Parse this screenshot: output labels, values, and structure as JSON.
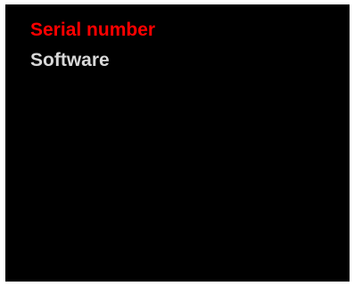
{
  "menu": {
    "items": [
      {
        "label": "Serial number",
        "selected": true
      },
      {
        "label": "Software",
        "selected": false
      }
    ]
  },
  "colors": {
    "background": "#000000",
    "selected_text": "#ff0000",
    "normal_text": "#d8d8d8",
    "border": "#ffffff"
  }
}
